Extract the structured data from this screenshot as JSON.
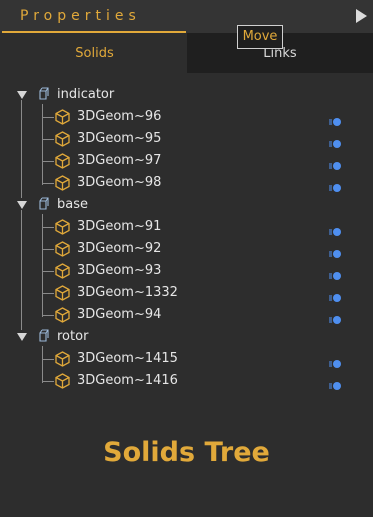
{
  "panel": {
    "title": "Properties"
  },
  "tabs": [
    {
      "label": "Solids",
      "active": true
    },
    {
      "label": "Links",
      "active": false
    }
  ],
  "tooltip": {
    "text": "Move"
  },
  "tree": {
    "groups": [
      {
        "label": "indicator",
        "items": [
          "3DGeom~96",
          "3DGeom~95",
          "3DGeom~97",
          "3DGeom~98"
        ]
      },
      {
        "label": "base",
        "items": [
          "3DGeom~91",
          "3DGeom~92",
          "3DGeom~93",
          "3DGeom~1332",
          "3DGeom~94"
        ]
      },
      {
        "label": "rotor",
        "items": [
          "3DGeom~1415",
          "3DGeom~1416"
        ]
      }
    ]
  },
  "footer": {
    "caption": "Solids Tree"
  },
  "colors": {
    "accent": "#e1a93a",
    "background": "#2d2d2d",
    "dot": "#4f8ff0",
    "text": "#e6e6e6"
  }
}
